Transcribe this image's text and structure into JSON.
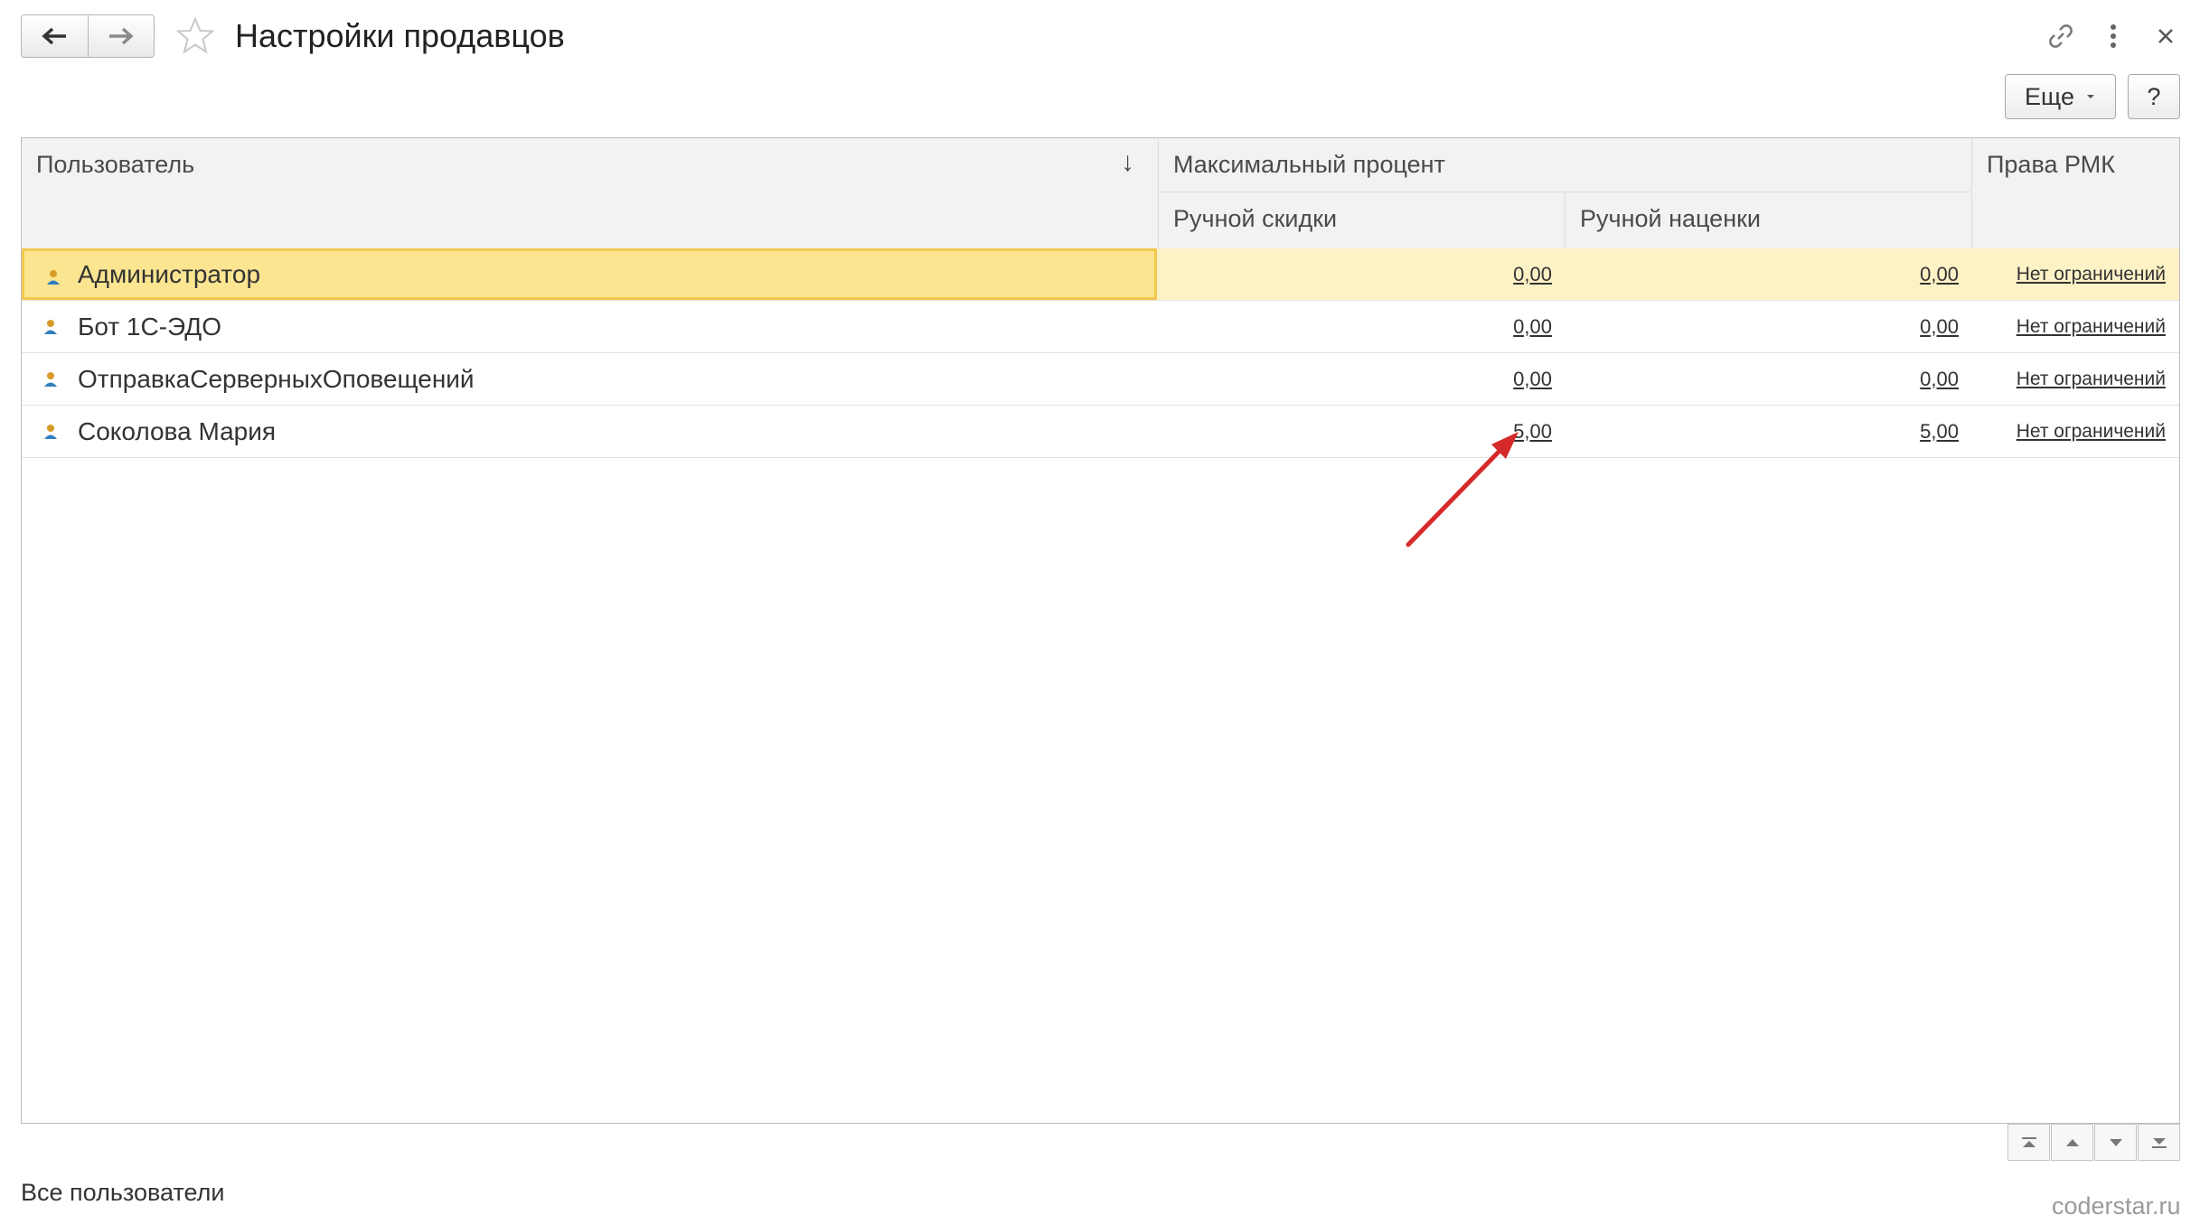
{
  "window": {
    "title": "Настройки продавцов",
    "back_icon": "arrow-left-icon",
    "forward_icon": "arrow-right-icon",
    "favorite_icon": "star-icon",
    "link_icon": "link-icon",
    "menu_icon": "more-vertical-icon",
    "close_icon": "close-icon"
  },
  "toolbar": {
    "more_label": "Еще",
    "help_label": "?"
  },
  "table": {
    "columns": {
      "user": "Пользователь",
      "sort_indicator": "↓",
      "max_percent": "Максимальный процент",
      "manual_discount": "Ручной скидки",
      "manual_markup": "Ручной наценки",
      "rmk_rights": "Права РМК"
    },
    "rows": [
      {
        "user": "Администратор",
        "discount": "0,00",
        "markup": "0,00",
        "rmk": "Нет ограничений",
        "selected": true
      },
      {
        "user": "Бот 1С-ЭДО",
        "discount": "0,00",
        "markup": "0,00",
        "rmk": "Нет ограничений",
        "selected": false
      },
      {
        "user": "ОтправкаСерверныхОповещений",
        "discount": "0,00",
        "markup": "0,00",
        "rmk": "Нет ограничений",
        "selected": false
      },
      {
        "user": "Соколова Мария",
        "discount": "5,00",
        "markup": "5,00",
        "rmk": "Нет ограничений",
        "selected": false
      }
    ]
  },
  "footer": {
    "filter_label": "Все пользователи",
    "watermark": "coderstar.ru"
  },
  "colors": {
    "selected_row": "#fdf2c6",
    "selected_cell": "#fbe591",
    "selected_border": "#f2c94c",
    "annotation_arrow": "#d62a2a"
  }
}
